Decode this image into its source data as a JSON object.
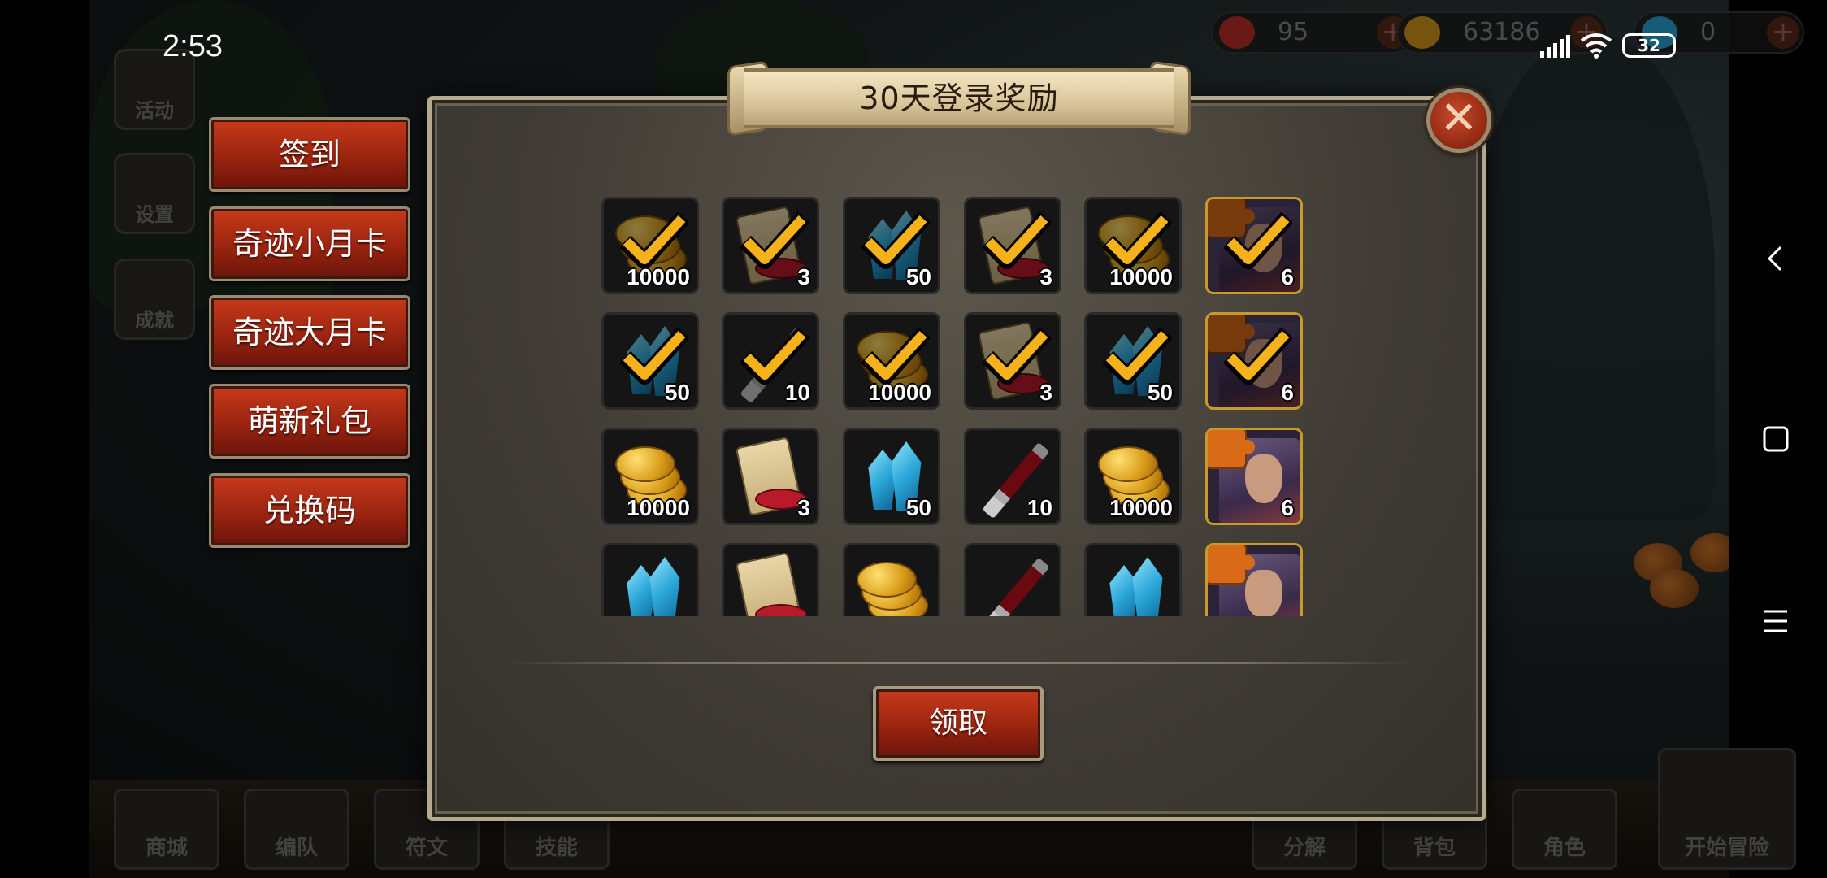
{
  "status_bar": {
    "time": "2:53",
    "battery": "32"
  },
  "resources": [
    {
      "name": "hearts",
      "value": "95",
      "icon": "heart-icon",
      "color": "#c0302a"
    },
    {
      "name": "coins",
      "value": "63186",
      "icon": "coin-icon",
      "color": "#d89a18"
    },
    {
      "name": "crystals",
      "value": "0",
      "icon": "crystal-icon",
      "color": "#2aa6d8"
    }
  ],
  "background_side_buttons": [
    "活动",
    "设置",
    "成就"
  ],
  "background_bottom_nav": [
    "商城",
    "编队",
    "符文",
    "技能",
    "分解",
    "背包",
    "角色",
    "开始冒险"
  ],
  "left_menu": [
    {
      "label": "签到"
    },
    {
      "label": "奇迹小月卡"
    },
    {
      "label": "奇迹大月卡"
    },
    {
      "label": "萌新礼包"
    },
    {
      "label": "兑换码"
    }
  ],
  "dialog": {
    "title": "30天登录奖励",
    "close_icon": "close-icon",
    "claim_label": "领取"
  },
  "rewards": [
    [
      {
        "item": "coins",
        "count": "10000",
        "claimed": true
      },
      {
        "item": "scroll",
        "count": "3",
        "claimed": true
      },
      {
        "item": "crystal",
        "count": "50",
        "claimed": true
      },
      {
        "item": "scroll",
        "count": "3",
        "claimed": true
      },
      {
        "item": "coins",
        "count": "10000",
        "claimed": true
      },
      {
        "item": "hero-fragment",
        "count": "6",
        "claimed": true
      }
    ],
    [
      {
        "item": "crystal",
        "count": "50",
        "claimed": true
      },
      {
        "item": "syringe",
        "count": "10",
        "claimed": true
      },
      {
        "item": "coins",
        "count": "10000",
        "claimed": true
      },
      {
        "item": "scroll",
        "count": "3",
        "claimed": true
      },
      {
        "item": "crystal",
        "count": "50",
        "claimed": true
      },
      {
        "item": "hero-fragment",
        "count": "6",
        "claimed": true
      }
    ],
    [
      {
        "item": "coins",
        "count": "10000",
        "claimed": false
      },
      {
        "item": "scroll",
        "count": "3",
        "claimed": false
      },
      {
        "item": "crystal",
        "count": "50",
        "claimed": false
      },
      {
        "item": "syringe",
        "count": "10",
        "claimed": false
      },
      {
        "item": "coins",
        "count": "10000",
        "claimed": false
      },
      {
        "item": "hero-fragment",
        "count": "6",
        "claimed": false
      }
    ],
    [
      {
        "item": "crystal",
        "count": "",
        "claimed": false
      },
      {
        "item": "scroll",
        "count": "",
        "claimed": false
      },
      {
        "item": "coins",
        "count": "",
        "claimed": false
      },
      {
        "item": "syringe",
        "count": "",
        "claimed": false
      },
      {
        "item": "crystal",
        "count": "",
        "claimed": false
      },
      {
        "item": "hero-fragment",
        "count": "",
        "claimed": false
      }
    ]
  ],
  "system_nav": [
    "back-icon",
    "home-icon",
    "menu-icon"
  ]
}
